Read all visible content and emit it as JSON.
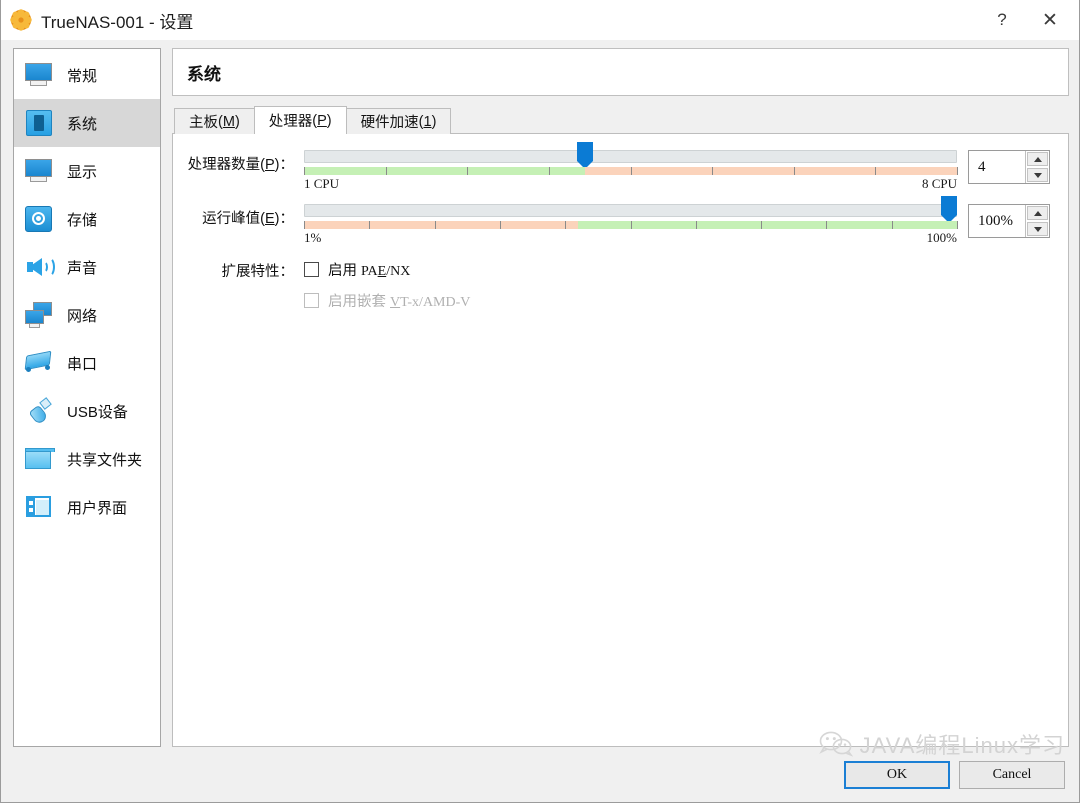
{
  "window": {
    "title": "TrueNAS-001 - 设置",
    "icon": "vm-settings-gear-icon",
    "help_label": "?",
    "close_label": "✕"
  },
  "sidebar": {
    "items": [
      {
        "label": "常规",
        "icon": "monitor-icon",
        "selected": false
      },
      {
        "label": "系统",
        "icon": "chip-icon",
        "selected": true
      },
      {
        "label": "显示",
        "icon": "monitor-icon",
        "selected": false
      },
      {
        "label": "存储",
        "icon": "harddisk-icon",
        "selected": false
      },
      {
        "label": "声音",
        "icon": "speaker-icon",
        "selected": false
      },
      {
        "label": "网络",
        "icon": "network-icon",
        "selected": false
      },
      {
        "label": "串口",
        "icon": "serial-port-icon",
        "selected": false
      },
      {
        "label": "USB设备",
        "icon": "usb-icon",
        "selected": false
      },
      {
        "label": "共享文件夹",
        "icon": "folder-icon",
        "selected": false
      },
      {
        "label": "用户界面",
        "icon": "ui-window-icon",
        "selected": false
      }
    ]
  },
  "main": {
    "page_title": "系统",
    "tabs": [
      {
        "label": "主板",
        "accel": "M",
        "active": false
      },
      {
        "label": "处理器",
        "accel": "P",
        "active": true
      },
      {
        "label": "硬件加速",
        "accel": "1",
        "active": false
      }
    ],
    "cpu_count": {
      "label": "处理器数量",
      "accel": "P",
      "min_label": "1 CPU",
      "max_label": "8 CPU",
      "value": "4",
      "handle_percent": 43,
      "ticks": 8
    },
    "exec_cap": {
      "label": "运行峰值",
      "accel": "E",
      "min_label": "1%",
      "max_label": "100%",
      "value": "100%",
      "handle_percent": 99,
      "ticks": 10,
      "green_start_percent": 42
    },
    "extended_features": {
      "label": "扩展特性",
      "items": [
        {
          "prefix": "启用",
          "accel": "E",
          "name": "PAE/NX",
          "checked": false,
          "disabled": false
        },
        {
          "prefix": "启用嵌套",
          "accel": "V",
          "name": "VT-x/AMD-V",
          "checked": false,
          "disabled": true
        }
      ]
    }
  },
  "footer": {
    "ok_label": "OK",
    "cancel_label": "Cancel"
  },
  "watermark": {
    "text": "JAVA编程Linux学习",
    "icon": "wechat-logo-icon"
  },
  "colors": {
    "accent": "#0b7bd4",
    "slider_green": "#c5f0b5",
    "slider_salmon": "#fbd3bb",
    "selection": "#d7d7d7",
    "title_icon": "#f2a01e"
  }
}
